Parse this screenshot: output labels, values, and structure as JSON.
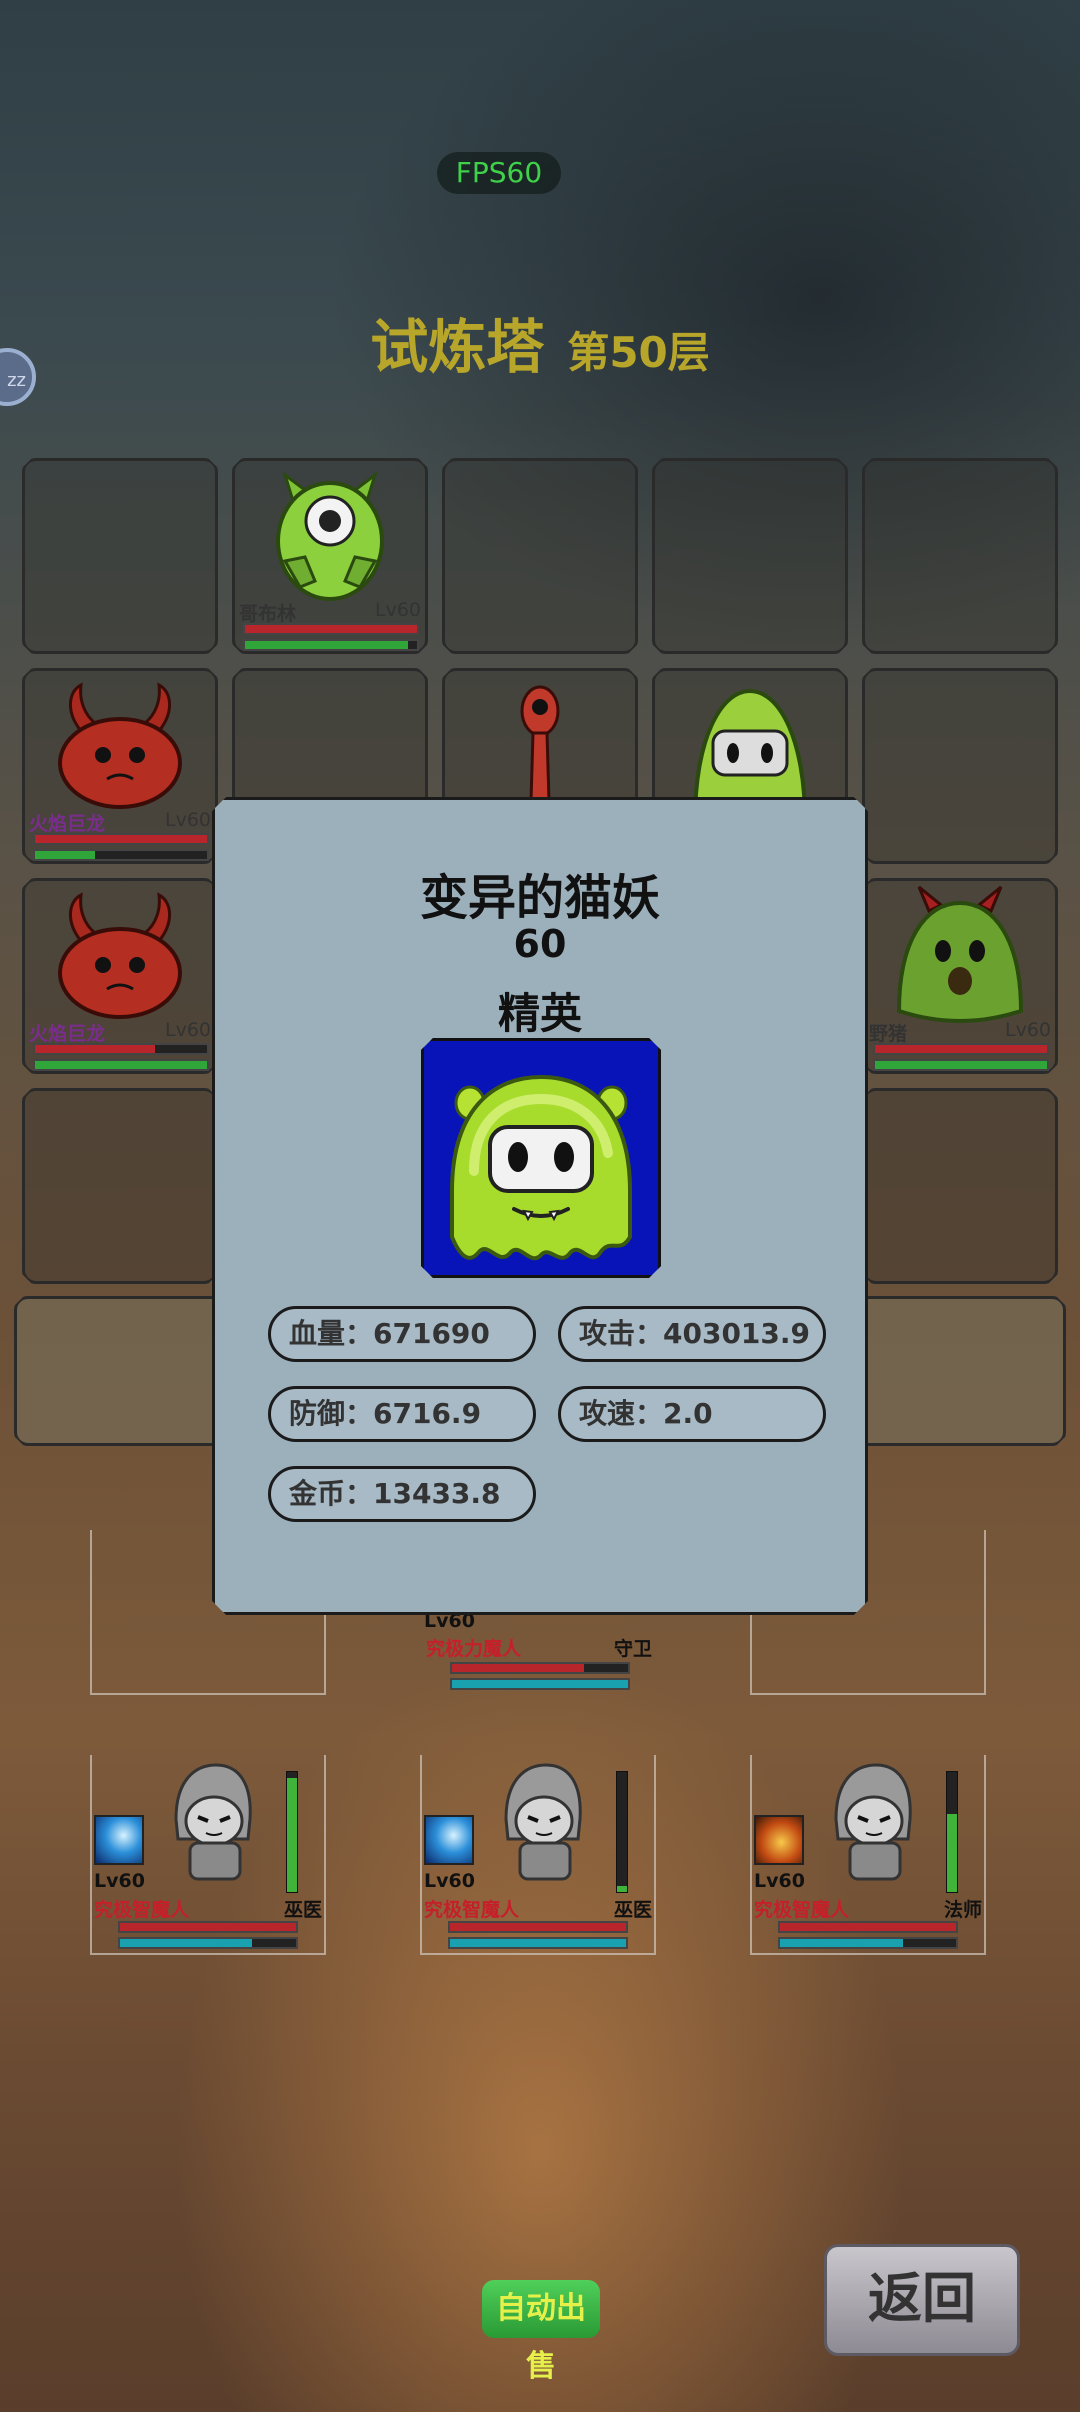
{
  "hud": {
    "fps": "FPS60",
    "sleep_badge": "zz"
  },
  "title": {
    "name": "试炼塔",
    "floor": "第50层"
  },
  "grid": {
    "slots": [
      {
        "row": 0,
        "col": 1,
        "name": "哥布林",
        "level": "Lv60",
        "name_color": "#333333",
        "hp": 1.0,
        "energy": 0.95
      },
      {
        "row": 1,
        "col": 0,
        "name": "火焰巨龙",
        "level": "Lv60",
        "name_color": "#7a2d8c",
        "hp": 1.0,
        "energy": 0.35
      },
      {
        "row": 2,
        "col": 0,
        "name": "火焰巨龙",
        "level": "Lv60",
        "name_color": "#7a2d8c",
        "hp": 0.7,
        "energy": 1.0
      },
      {
        "row": 2,
        "col": 4,
        "name": "野猪",
        "level": "Lv60",
        "name_color": "#333333",
        "hp": 1.0,
        "energy": 1.0
      }
    ]
  },
  "popup": {
    "name": "变异的猫妖",
    "level": "60",
    "rank": "精英",
    "stats": {
      "hp": "血量：671690",
      "attack": "攻击：403013.9",
      "defense": "防御：6716.9",
      "attack_speed": "攻速：2.0",
      "gold": "金币：13433.8"
    }
  },
  "heroes": {
    "front": {
      "level": "Lv60",
      "name": "究极力魔人",
      "role": "守卫",
      "hp": 0.75,
      "mana": 1.0
    },
    "back": [
      {
        "level": "Lv60",
        "name": "究极智魔人",
        "role": "巫医",
        "hp": 1.0,
        "mana": 0.75,
        "energy": 0.95,
        "skill": "ice-skill-icon"
      },
      {
        "level": "Lv60",
        "name": "究极智魔人",
        "role": "巫医",
        "hp": 1.0,
        "mana": 1.0,
        "energy": 0.05,
        "skill": "ice-skill-icon"
      },
      {
        "level": "Lv60",
        "name": "究极智魔人",
        "role": "法师",
        "hp": 1.0,
        "mana": 0.7,
        "energy": 0.65,
        "skill": "fire-skill-icon"
      }
    ]
  },
  "buttons": {
    "auto_sell": "自动出售",
    "back": "返回"
  }
}
